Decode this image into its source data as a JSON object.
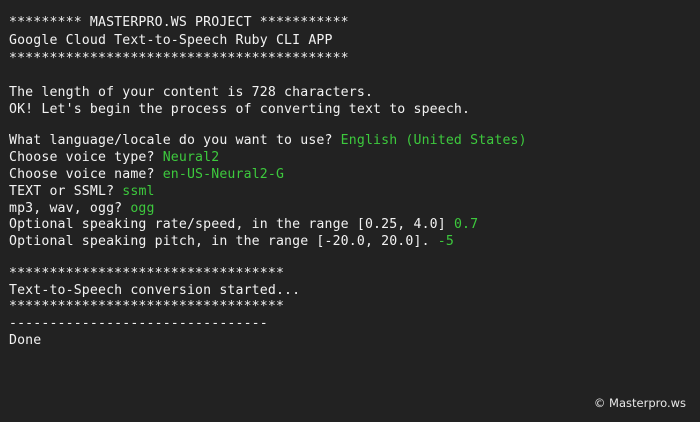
{
  "terminal": {
    "stars_top": "********* MASTERPRO.WS PROJECT ***********",
    "subtitle": "Google Cloud Text-to-Speech Ruby CLI APP",
    "stars_long": "******************************************",
    "length_msg": "The length of your content is 728 characters.",
    "ok_msg": "OK! Let's begin the process of converting text to speech.",
    "q_language": "What language/locale do you want to use? ",
    "a_language": "English (United States)",
    "q_voice_type": "Choose voice type? ",
    "a_voice_type": "Neural2",
    "q_voice_name": "Choose voice name? ",
    "a_voice_name": "en-US-Neural2-G",
    "q_format": "TEXT or SSML? ",
    "a_format": "ssml",
    "q_audio": "mp3, wav, ogg? ",
    "a_audio": "ogg",
    "q_rate": "Optional speaking rate/speed, in the range [0.25, 4.0] ",
    "a_rate": "0.7",
    "q_pitch": "Optional speaking pitch, in the range [-20.0, 20.0]. ",
    "a_pitch": "-5",
    "stars_mid": "**********************************",
    "conversion_started": "Text-to-Speech conversion started...",
    "stars_mid2": "**********************************",
    "dashes": "--------------------------------",
    "done": "Done"
  },
  "watermark": "© Masterpro.ws",
  "colors": {
    "background": "#222222",
    "text": "#f2f2f2",
    "answer": "#3dc93d"
  }
}
